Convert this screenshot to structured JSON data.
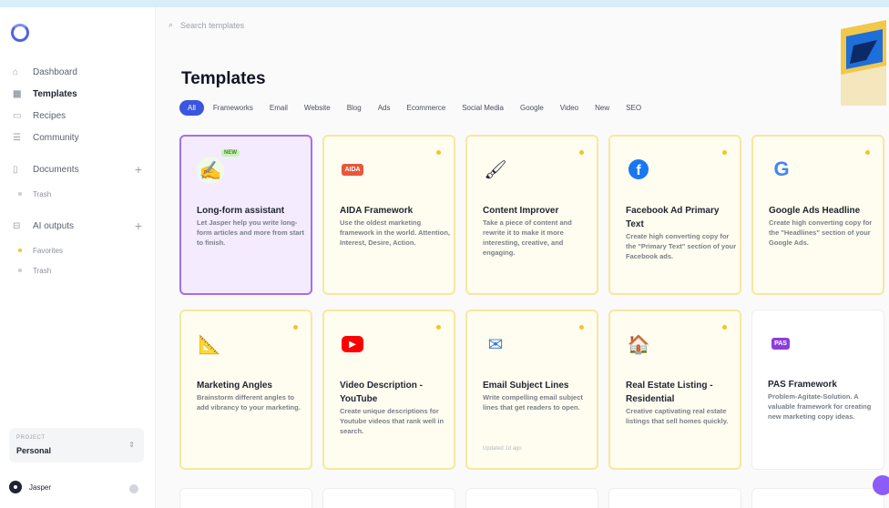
{
  "sidebar": {
    "nav": [
      {
        "label": "Dashboard",
        "icon": "home-icon"
      },
      {
        "label": "Templates",
        "icon": "grid-icon",
        "active": true
      },
      {
        "label": "Recipes",
        "icon": "book-icon"
      },
      {
        "label": "Community",
        "icon": "list-icon"
      }
    ],
    "documents": {
      "label": "Documents",
      "trash": "Trash"
    },
    "ai_outputs": {
      "label": "AI outputs",
      "favorites": "Favorites",
      "trash": "Trash"
    },
    "project": {
      "label": "PROJECT",
      "value": "Personal"
    },
    "user": {
      "name": "Jasper"
    }
  },
  "search": {
    "placeholder": "Search templates"
  },
  "page_title": "Templates",
  "tabs": [
    "All",
    "Frameworks",
    "Email",
    "Website",
    "Blog",
    "Ads",
    "Ecommerce",
    "Social Media",
    "Google",
    "Video",
    "New",
    "SEO"
  ],
  "cards": [
    {
      "name": "Long-form assistant",
      "desc": "Let Jasper help you write long-form articles and more from start to finish.",
      "icon": "✍",
      "badge": "NEW"
    },
    {
      "name": "AIDA Framework",
      "desc": "Use the oldest marketing framework in the world. Attention, Interest, Desire, Action.",
      "icon": "AIDA"
    },
    {
      "name": "Content Improver",
      "desc": "Take a piece of content and rewrite it to make it more interesting, creative, and engaging.",
      "icon": "🖌"
    },
    {
      "name": "Facebook Ad Primary Text",
      "desc": "Create high converting copy for the \"Primary Text\" section of your Facebook ads.",
      "icon": "f"
    },
    {
      "name": "Google Ads Headline",
      "desc": "Create high converting copy for the \"Headlines\" section of your Google Ads.",
      "icon": "G"
    },
    {
      "name": "Marketing Angles",
      "desc": "Brainstorm different angles to add vibrancy to your marketing.",
      "icon": "📐"
    },
    {
      "name": "Video Description - YouTube",
      "desc": "Create unique descriptions for Youtube videos that rank well in search.",
      "icon": "▶"
    },
    {
      "name": "Email Subject Lines",
      "desc": "Write compelling email subject lines that get readers to open.",
      "icon": "✉",
      "foot": "Updated 1d ago"
    },
    {
      "name": "Real Estate Listing - Residential",
      "desc": "Creative captivating real estate listings that sell homes quickly.",
      "icon": "🏠"
    },
    {
      "name": "PAS Framework",
      "desc": "Problem-Agitate-Solution. A valuable framework for creating new marketing copy ideas.",
      "icon": "PAS"
    }
  ]
}
